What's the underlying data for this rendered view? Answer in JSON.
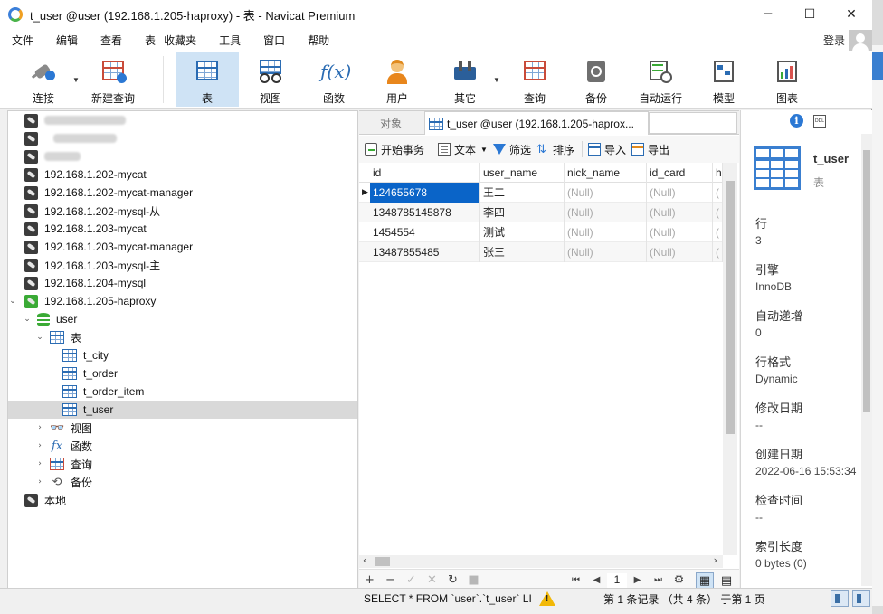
{
  "window": {
    "title": "t_user @user (192.168.1.205-haproxy) - 表 - Navicat Premium",
    "controls": [
      "─",
      "☐",
      "✕"
    ]
  },
  "menu": {
    "items": [
      "文件",
      "编辑",
      "查看",
      "表",
      "收藏夹",
      "工具",
      "窗口",
      "帮助"
    ],
    "login_label": "登录"
  },
  "toolbar": {
    "items": [
      {
        "label": "连接",
        "icon": "plug-icon"
      },
      {
        "label": "新建查询",
        "icon": "new-query-icon"
      },
      {
        "label": "表",
        "icon": "table-icon"
      },
      {
        "label": "视图",
        "icon": "view-icon"
      },
      {
        "label": "函数",
        "icon": "function-icon"
      },
      {
        "label": "用户",
        "icon": "user-icon"
      },
      {
        "label": "其它",
        "icon": "tools-icon"
      },
      {
        "label": "查询",
        "icon": "query-icon"
      },
      {
        "label": "备份",
        "icon": "backup-icon"
      },
      {
        "label": "自动运行",
        "icon": "auto-run-icon"
      },
      {
        "label": "模型",
        "icon": "model-icon"
      },
      {
        "label": "图表",
        "icon": "chart-icon"
      }
    ],
    "active": "表"
  },
  "tree": {
    "connections": [
      "192.168.1.202-mycat",
      "192.168.1.202-mycat-manager",
      "192.168.1.202-mysql-从",
      "192.168.1.203-mycat",
      "192.168.1.203-mycat-manager",
      "192.168.1.203-mysql-主",
      "192.168.1.204-mysql",
      "192.168.1.205-haproxy"
    ],
    "database": "user",
    "tables_group": "表",
    "tables": [
      "t_city",
      "t_order",
      "t_order_item",
      "t_user"
    ],
    "selected_table": "t_user",
    "other_groups": [
      "视图",
      "函数",
      "查询",
      "备份"
    ],
    "local": "本地",
    "fx_glyph": "fx"
  },
  "tabs": {
    "objects": "对象",
    "current": "t_user @user (192.168.1.205-haprox..."
  },
  "subtoolbar": {
    "begin_tx": "开始事务",
    "text": "文本",
    "filter": "筛选",
    "sort": "排序",
    "import": "导入",
    "export": "导出"
  },
  "grid": {
    "columns": [
      "id",
      "user_name",
      "nick_name",
      "id_card",
      "h"
    ],
    "rows": [
      [
        "124655678",
        "王二",
        "(Null)",
        "(Null)",
        "("
      ],
      [
        "1348785145878",
        "李四",
        "(Null)",
        "(Null)",
        "("
      ],
      [
        "1454554",
        "测试",
        "(Null)",
        "(Null)",
        "("
      ],
      [
        "13487855485",
        "张三",
        "(Null)",
        "(Null)",
        "("
      ]
    ],
    "selected_cell": "124655678",
    "row_marker": "▶"
  },
  "navbar": {
    "add": "+",
    "remove": "−",
    "apply": "✓",
    "discard": "✕",
    "refresh": "↻",
    "stop": "■",
    "first": "⏮",
    "prev": "◀",
    "page": "1",
    "next": "▶",
    "last": "⏭",
    "settings": "⚙",
    "grid_view": "▦",
    "form_view": "▤"
  },
  "info_panel": {
    "name": "t_user",
    "type": "表",
    "info_icon": "i",
    "ddl_icon": "DDL",
    "props": [
      {
        "label": "行",
        "value": "3"
      },
      {
        "label": "引擎",
        "value": "InnoDB"
      },
      {
        "label": "自动递增",
        "value": "0"
      },
      {
        "label": "行格式",
        "value": "Dynamic"
      },
      {
        "label": "修改日期",
        "value": "--"
      },
      {
        "label": "创建日期",
        "value": "2022-06-16 15:53:34"
      },
      {
        "label": "检查时间",
        "value": "--"
      },
      {
        "label": "索引长度",
        "value": "0 bytes (0)"
      }
    ]
  },
  "status": {
    "sql": "SELECT * FROM `user`.`t_user` LI",
    "warning": "!",
    "record_info": "第 1 条记录 （共 4 条） 于第 1 页"
  },
  "colors": {
    "accent": "#0a64c8",
    "toolbar_active": "#cfe3f5",
    "connection_active": "#3aaa35",
    "null_text": "#a8a8a8"
  }
}
